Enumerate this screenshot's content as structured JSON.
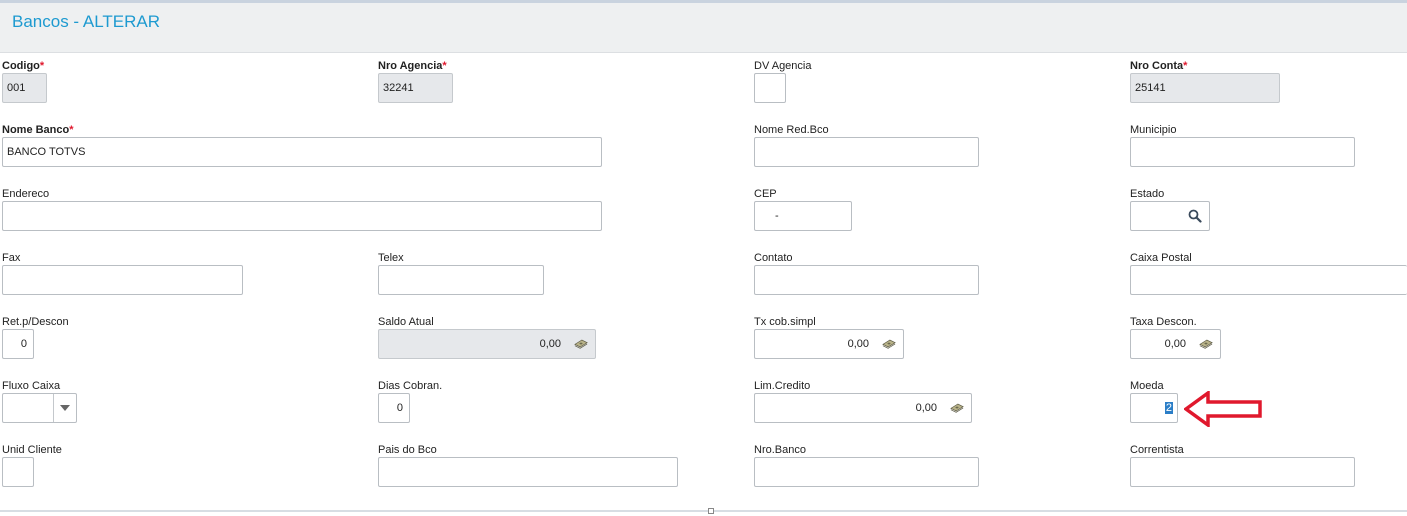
{
  "page": {
    "title": "Bancos - ALTERAR"
  },
  "fields": {
    "codigo": {
      "label": "Codigo",
      "required": "*",
      "value": "001"
    },
    "nro_agencia": {
      "label": "Nro Agencia",
      "required": "*",
      "value": "32241"
    },
    "dv_agencia": {
      "label": "DV Agencia",
      "value": ""
    },
    "nro_conta": {
      "label": "Nro Conta",
      "required": "*",
      "value": "25141"
    },
    "nome_banco": {
      "label": "Nome Banco",
      "required": "*",
      "value": "BANCO TOTVS"
    },
    "nome_red_bco": {
      "label": "Nome Red.Bco",
      "value": ""
    },
    "municipio": {
      "label": "Municipio",
      "value": ""
    },
    "endereco": {
      "label": "Endereco",
      "value": ""
    },
    "cep": {
      "label": "CEP",
      "value": "-"
    },
    "estado": {
      "label": "Estado",
      "value": "",
      "icon": "search-icon"
    },
    "fax": {
      "label": "Fax",
      "value": ""
    },
    "telex": {
      "label": "Telex",
      "value": ""
    },
    "contato": {
      "label": "Contato",
      "value": ""
    },
    "caixa_postal": {
      "label": "Caixa Postal",
      "value": ""
    },
    "ret_p_descon": {
      "label": "Ret.p/Descon",
      "value": "0"
    },
    "saldo_atual": {
      "label": "Saldo Atual",
      "value": "0,00",
      "icon": "money-icon"
    },
    "tx_cob_simpl": {
      "label": "Tx cob.simpl",
      "value": "0,00",
      "icon": "money-icon"
    },
    "taxa_descon": {
      "label": "Taxa Descon.",
      "value": "0,00",
      "icon": "money-icon"
    },
    "fluxo_caixa": {
      "label": "Fluxo Caixa",
      "value": "",
      "icon": "chevron-down-icon"
    },
    "dias_cobran": {
      "label": "Dias Cobran.",
      "value": "0"
    },
    "lim_credito": {
      "label": "Lim.Credito",
      "value": "0,00",
      "icon": "money-icon"
    },
    "moeda": {
      "label": "Moeda",
      "value": "2"
    },
    "unid_cliente": {
      "label": "Unid Cliente",
      "value": ""
    },
    "pais_do_bco": {
      "label": "Pais do Bco",
      "value": ""
    },
    "nro_banco": {
      "label": "Nro.Banco",
      "value": ""
    },
    "correntista": {
      "label": "Correntista",
      "value": ""
    }
  },
  "annotation": {
    "icon": "arrow-left-icon",
    "color": "#e0182d"
  },
  "colors": {
    "title": "#1d9ad0",
    "required": "#e0182d",
    "readonly_bg": "#e6e8eb",
    "selection": "#2b7ec7"
  }
}
